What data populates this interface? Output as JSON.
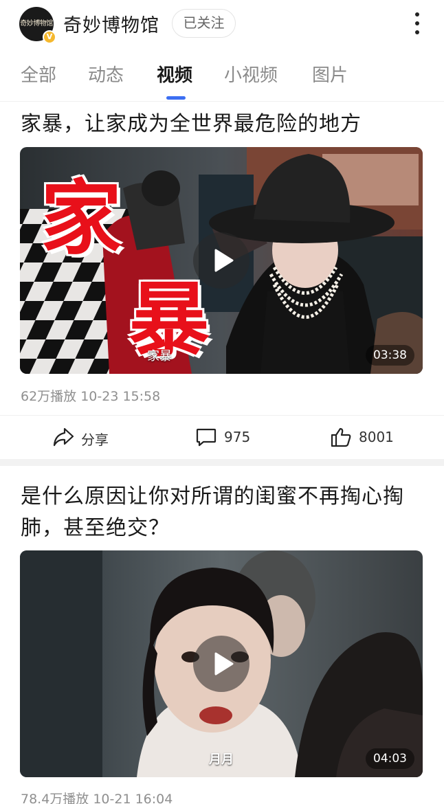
{
  "header": {
    "avatar_text": "奇妙博物馆",
    "verified_badge": "V",
    "account_name": "奇妙博物馆",
    "follow_label": "已关注"
  },
  "tabs": [
    {
      "label": "全部",
      "active": false
    },
    {
      "label": "动态",
      "active": false
    },
    {
      "label": "视频",
      "active": true
    },
    {
      "label": "小视频",
      "active": false
    },
    {
      "label": "图片",
      "active": false
    }
  ],
  "posts": [
    {
      "title": "家暴，让家成为全世界最危险的地方",
      "thumbnail_overlay_text": [
        "家",
        "暴"
      ],
      "caption": "家暴",
      "duration": "03:38",
      "meta": "62万播放  10-23 15:58",
      "share_label": "分享",
      "comments": "975",
      "likes": "8001"
    },
    {
      "title": "是什么原因让你对所谓的闺蜜不再掏心掏肺，甚至绝交？",
      "caption": "月月",
      "duration": "04:03",
      "meta": "78.4万播放  10-21 16:04"
    }
  ],
  "colors": {
    "accent": "#3d6ff2",
    "overlay_red": "#e8101a",
    "verified": "#f5b82e"
  }
}
